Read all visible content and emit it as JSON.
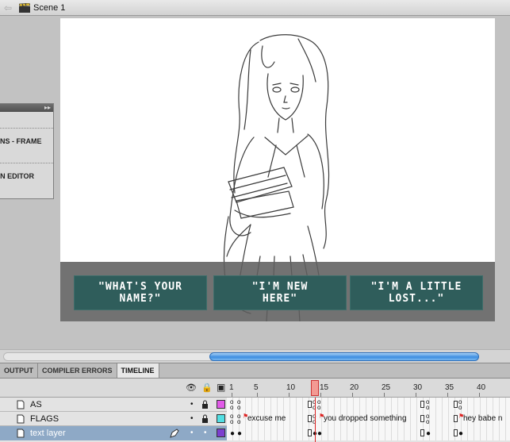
{
  "topbar": {
    "back_icon": "back-arrow-icon",
    "scene_icon": "clapperboard-icon",
    "scene_label": "Scene 1"
  },
  "float_panel": {
    "row1": "NS - FRAME",
    "row2": "N EDITOR"
  },
  "stage": {
    "choices": [
      {
        "label": "\"WHAT'S YOUR\nNAME?\""
      },
      {
        "label": "\"I'M NEW\nHERE\""
      },
      {
        "label": "\"I'M A LITTLE\nLOST...\""
      }
    ]
  },
  "tabs": [
    {
      "label": "OUTPUT",
      "active": false
    },
    {
      "label": "COMPILER ERRORS",
      "active": false
    },
    {
      "label": "TIMELINE",
      "active": true
    }
  ],
  "timeline": {
    "ruler": [
      "1",
      "5",
      "10",
      "15",
      "20",
      "25",
      "30",
      "35",
      "40"
    ],
    "current_frame": 14,
    "layers": [
      {
        "name": "AS",
        "color": "#e15be8",
        "selected": false
      },
      {
        "name": "FLAGS",
        "color": "#52dfe3",
        "selected": false,
        "frame_labels": [
          "excuse me",
          "you dropped something",
          "hey babe n"
        ]
      },
      {
        "name": "text layer",
        "color": "#7b3fcf",
        "selected": true
      }
    ]
  },
  "colors": {
    "stage_bg": "#ffffff",
    "choice_bg": "#2f5d5b",
    "dialog_strip": "#5f5f5f",
    "scroll_thumb": "#3d8de0"
  }
}
